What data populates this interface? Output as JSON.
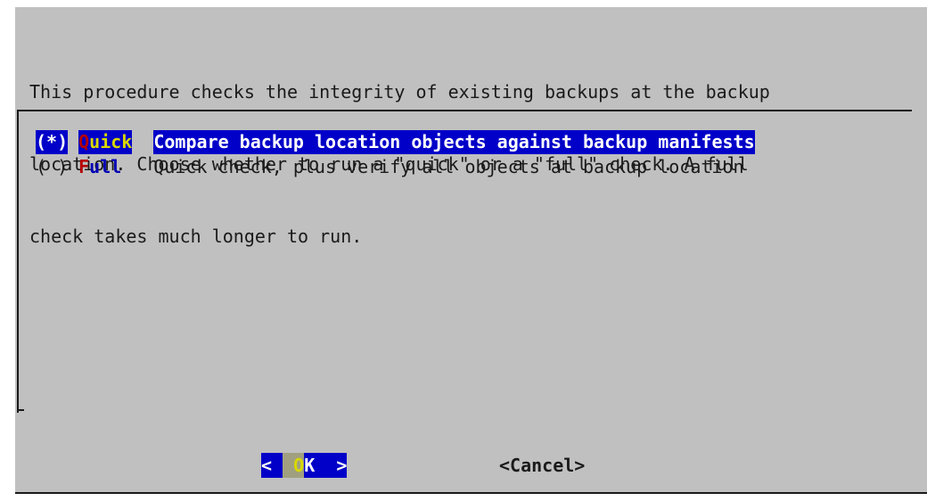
{
  "prompt": {
    "lines": [
      "This procedure checks the integrity of existing backups at the backup",
      "location. Choose whether to run a \"quick\" or a \"full\" check. A full",
      "check takes much longer to run."
    ]
  },
  "menu": {
    "items": [
      {
        "radio": "(*)",
        "tag_first": "Q",
        "tag_rest": "uick",
        "description": "Compare backup location objects against backup manifests",
        "selected": true
      },
      {
        "radio": "( )",
        "tag_first": "F",
        "tag_rest": "ull",
        "description": "Quick check, plus verify all objects at backup location",
        "selected": false
      }
    ]
  },
  "buttons": {
    "ok_left": "< ",
    "ok_hotkey": " O",
    "ok_rest": "K ",
    "ok_right": " >",
    "cancel_label": "<Cancel>"
  },
  "colors": {
    "dialog_bg": "#c0c0c0",
    "highlight_bg": "#0000c8",
    "hotkey_red": "#b40000",
    "hotkey_yellow": "#d8d800",
    "tag_blue": "#0000b4"
  }
}
